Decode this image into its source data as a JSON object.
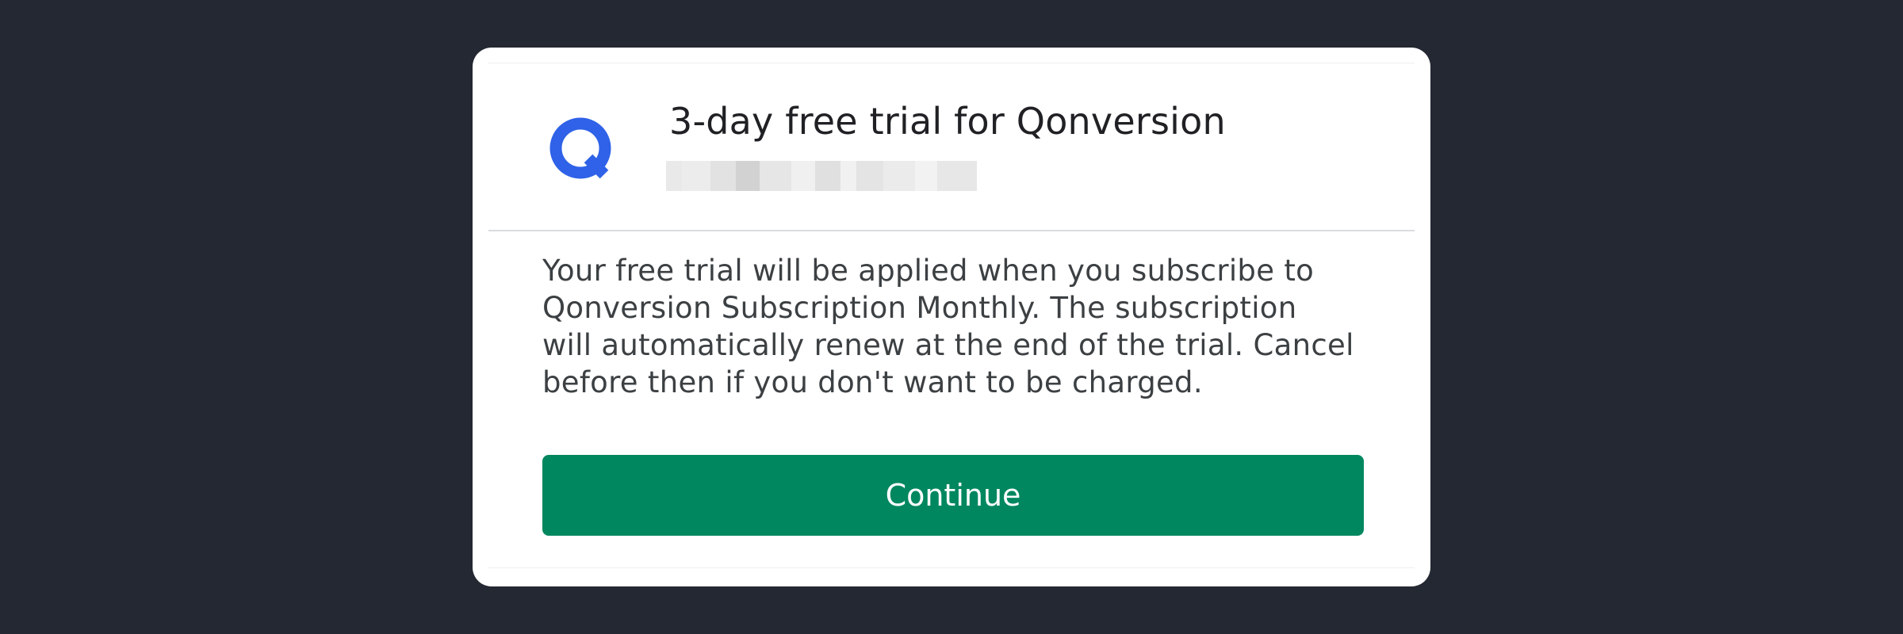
{
  "dialog": {
    "app_icon": "qonversion-q-icon",
    "title": "3-day free trial for Qonversion",
    "subtitle": "",
    "body_lines": [
      "Your free trial will be applied when you subscribe to",
      "Qonversion Subscription Monthly. The subscription",
      "will automatically renew at the end of the trial. Cancel",
      "before then if you don't want to be charged."
    ],
    "continue_label": "Continue"
  },
  "colors": {
    "background": "#242832",
    "dialog": "#ffffff",
    "brand_blue": "#2f62e8",
    "button_green": "#01875f",
    "title_text": "#202124",
    "body_text": "#3c4043"
  }
}
